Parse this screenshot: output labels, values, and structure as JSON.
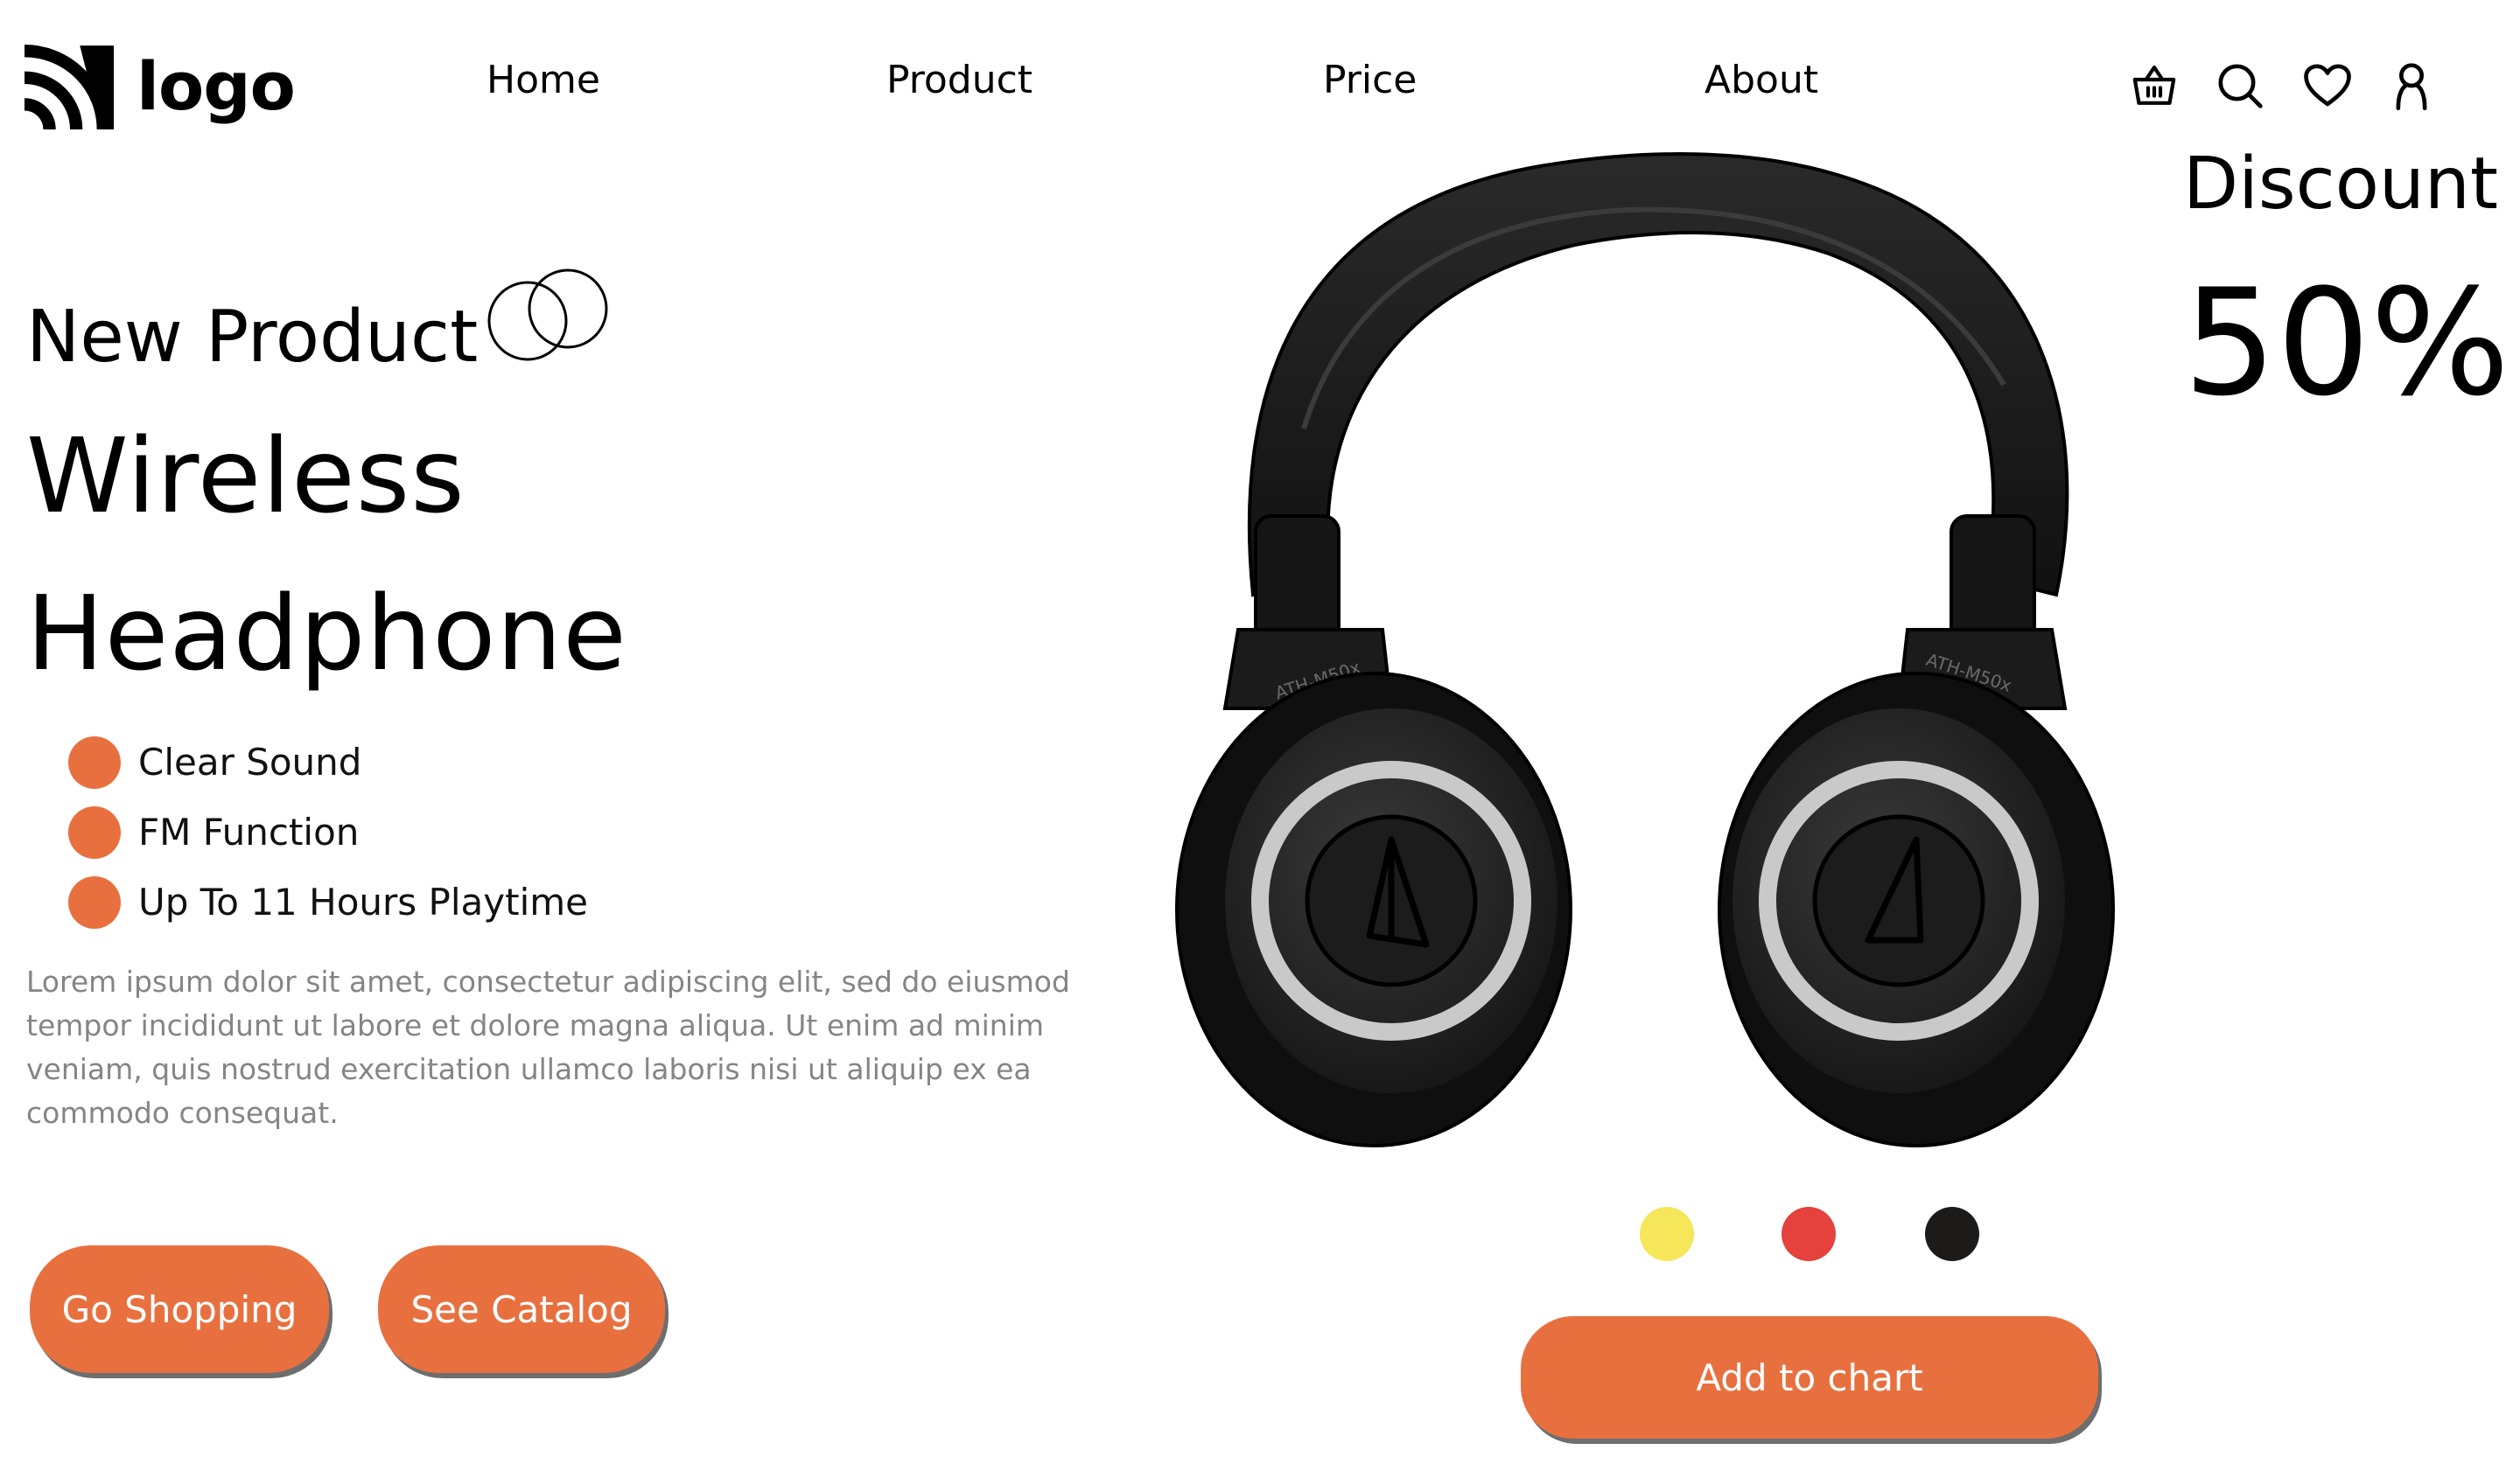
{
  "header": {
    "logo_text": "logo",
    "nav": [
      {
        "label": "Home"
      },
      {
        "label": "Product"
      },
      {
        "label": "Price"
      },
      {
        "label": "About"
      }
    ],
    "icons": [
      "basket-icon",
      "search-icon",
      "heart-icon",
      "user-icon"
    ]
  },
  "hero": {
    "eyebrow": "New Product",
    "title_line1": "Wireless",
    "title_line2": "Headphone",
    "features": [
      {
        "label": "Clear Sound"
      },
      {
        "label": "FM Function"
      },
      {
        "label": "Up To 11 Hours Playtime"
      }
    ],
    "description": "Lorem ipsum dolor sit amet, consectetur adipiscing elit, sed do eiusmod tempor incididunt ut labore et dolore magna aliqua. Ut enim ad minim veniam, quis nostrud exercitation ullamco laboris nisi ut aliquip ex ea commodo consequat.",
    "buttons": {
      "go_shopping": "Go Shopping",
      "see_catalog": "See Catalog"
    }
  },
  "product": {
    "model_left": "ATH-M50x",
    "model_right": "ATH-M50x",
    "discount_label": "Discount",
    "discount_value": "50%",
    "color_options": [
      {
        "name": "yellow",
        "color": "#f5e65a"
      },
      {
        "name": "red",
        "color": "#e5413d"
      },
      {
        "name": "black",
        "color": "#1d1a1a"
      }
    ],
    "add_to_cart_label": "Add to chart"
  },
  "theme": {
    "accent": "#e8703f",
    "text": "#000000",
    "muted_text": "#858585"
  }
}
